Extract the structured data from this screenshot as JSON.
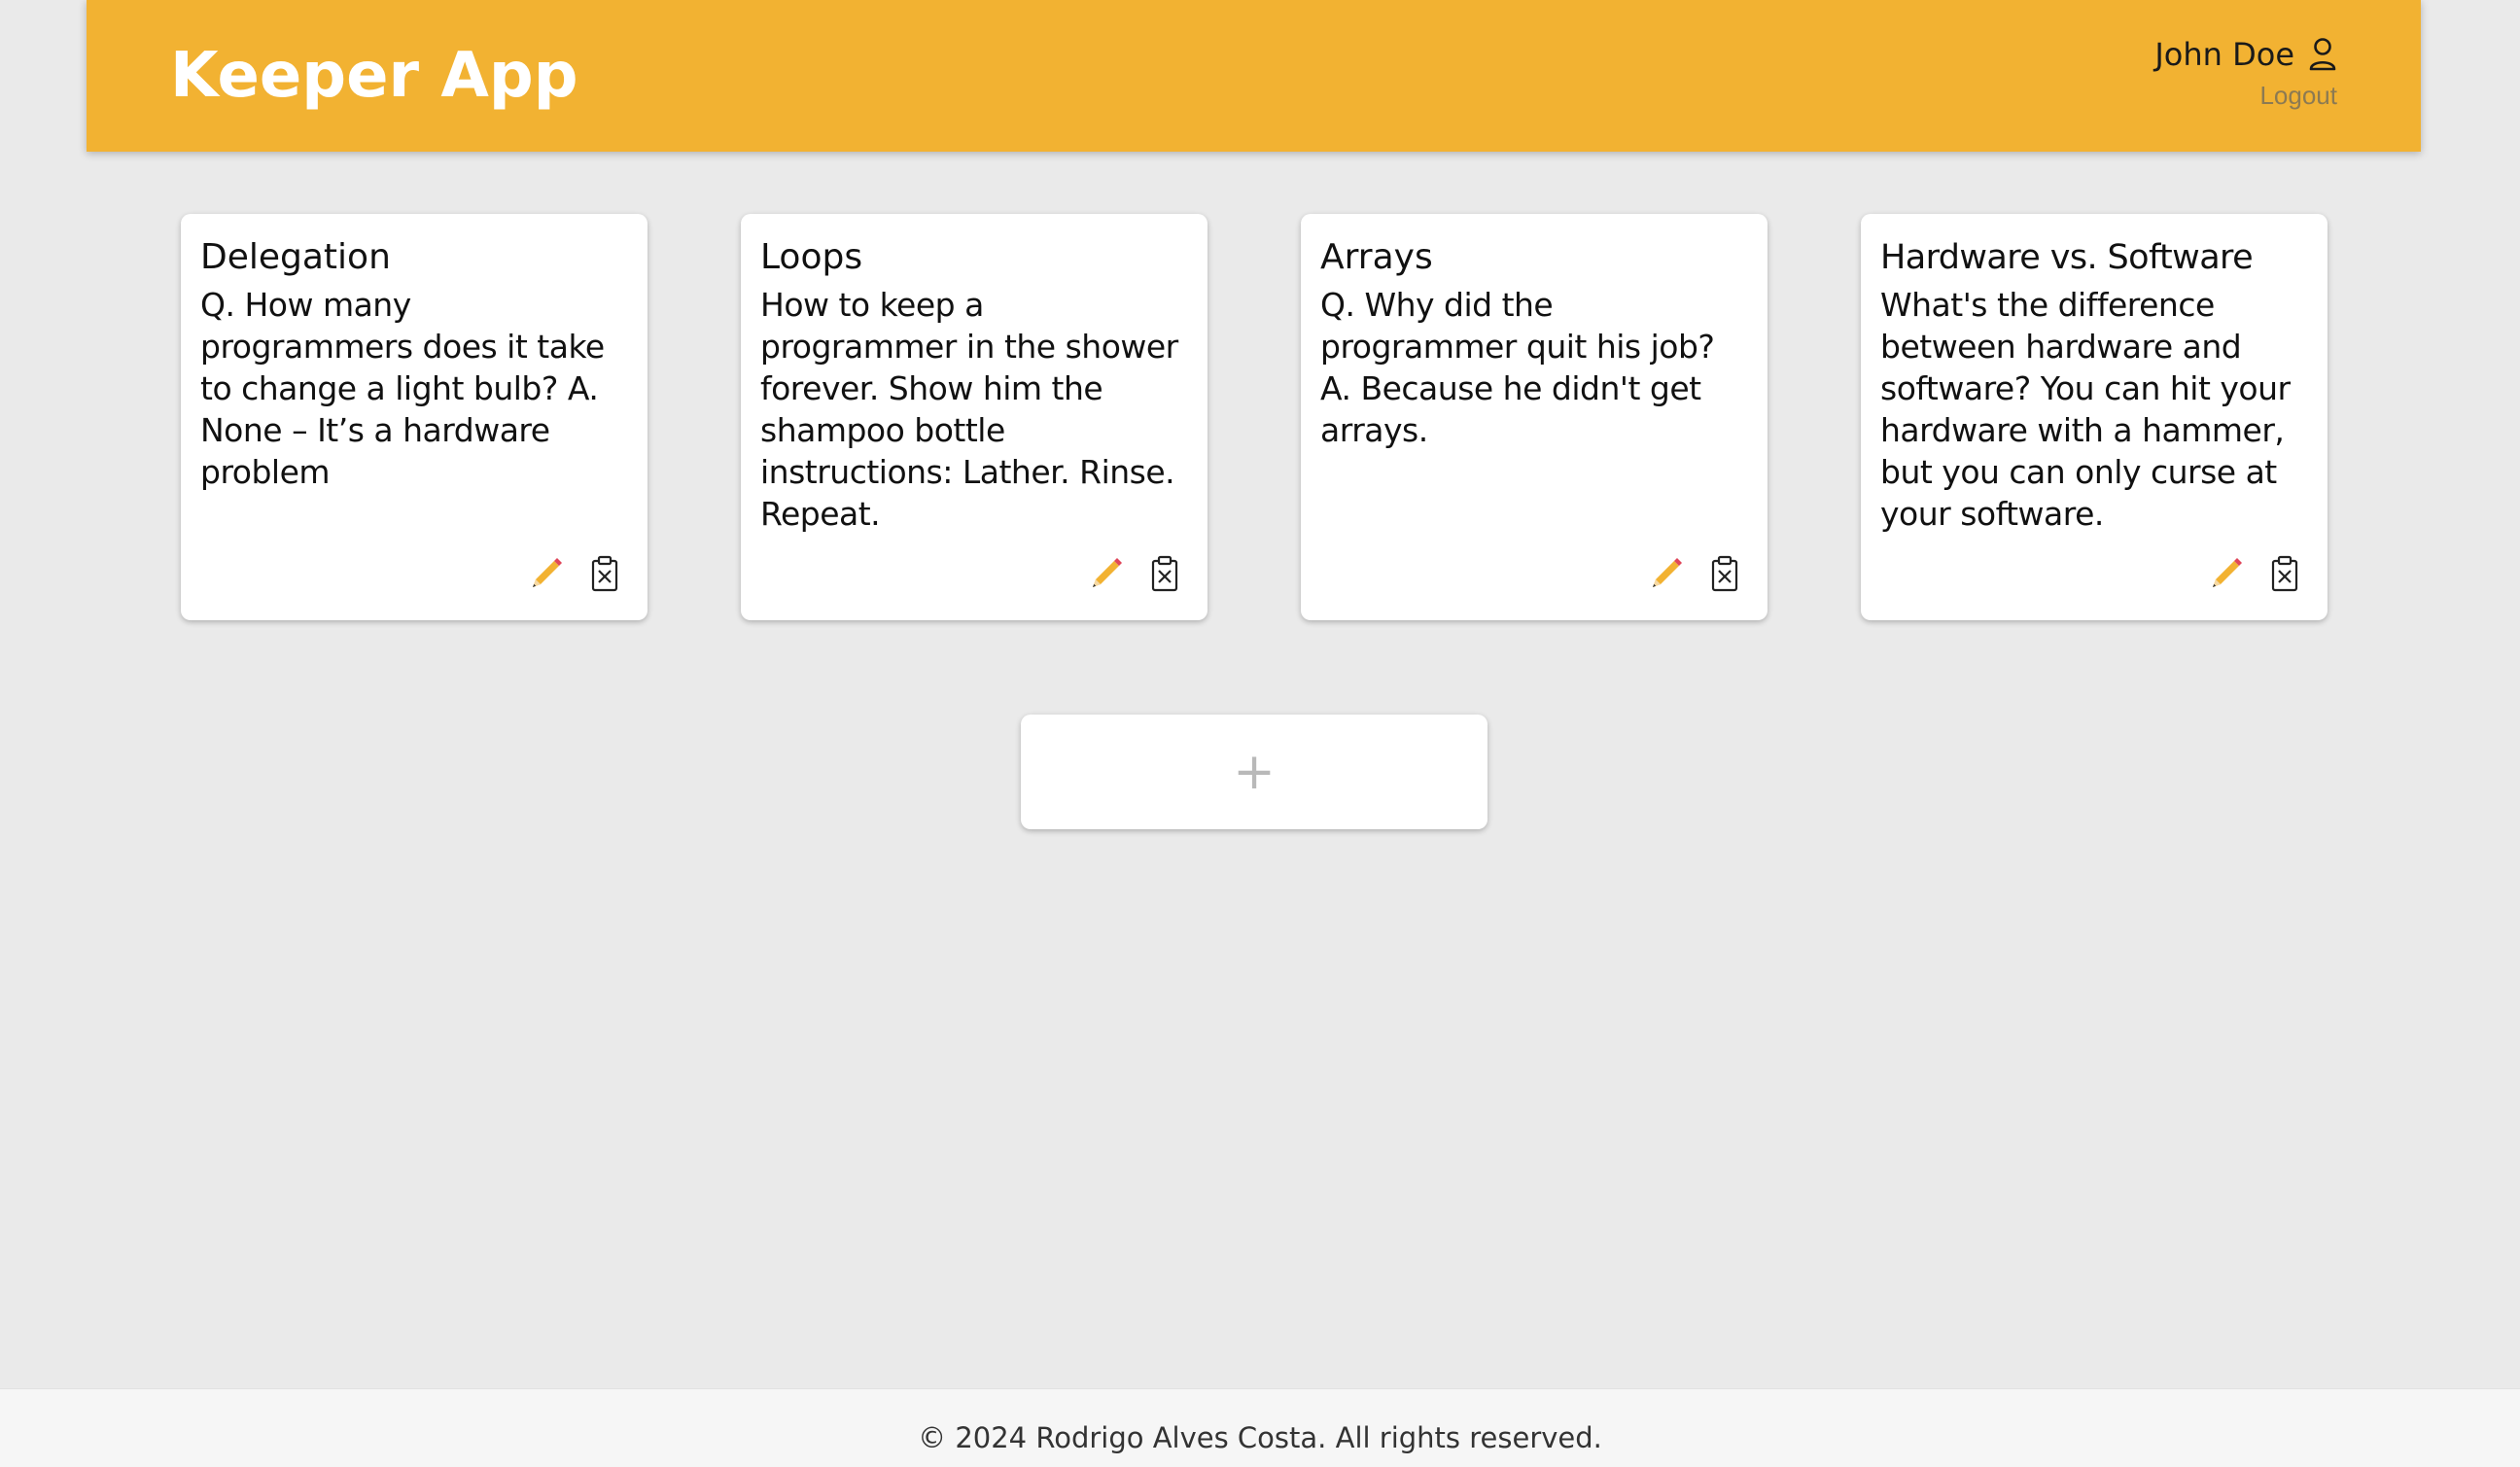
{
  "header": {
    "title": "Keeper App",
    "user_name": "John Doe",
    "logout_label": "Logout"
  },
  "notes": [
    {
      "title": "Delegation",
      "content": "Q. How many programmers does it take to change a light bulb? A. None – It’s a hardware problem"
    },
    {
      "title": "Loops",
      "content": "How to keep a programmer in the shower forever. Show him the shampoo bottle instructions: Lather. Rinse. Repeat."
    },
    {
      "title": "Arrays",
      "content": "Q. Why did the programmer quit his job? A. Because he didn't get arrays."
    },
    {
      "title": "Hardware vs. Software",
      "content": "What's the difference between hardware and software? You can hit your hardware with a hammer, but you can only curse at your software."
    }
  ],
  "add_note": {
    "label": "+"
  },
  "footer": {
    "text": "© 2024 Rodrigo Alves Costa. All rights reserved."
  },
  "colors": {
    "header_bg": "#f2b232",
    "page_bg": "#eaeaea",
    "edit_icon": "#f2b232"
  },
  "icons": {
    "user": "user-icon",
    "edit": "pencil-icon",
    "delete": "delete-clipboard-icon"
  }
}
